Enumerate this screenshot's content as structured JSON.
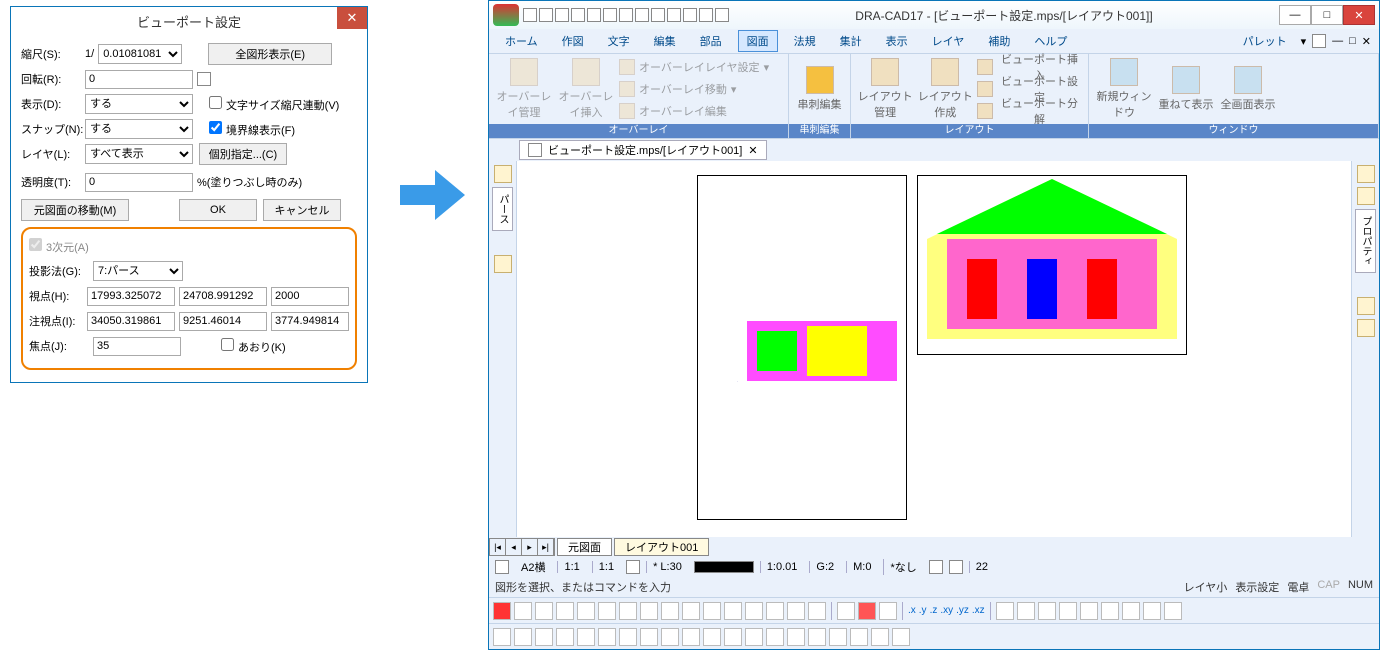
{
  "dialog": {
    "title": "ビューポート設定",
    "scale_label": "縮尺(S):",
    "scale_prefix": "1/",
    "scale_value": "0.01081081",
    "all_shapes_btn": "全図形表示(E)",
    "rotate_label": "回転(R):",
    "rotate_value": "0",
    "display_label": "表示(D):",
    "display_value": "する",
    "charsize_chk": "文字サイズ縮尺連動(V)",
    "snap_label": "スナップ(N):",
    "snap_value": "する",
    "boundary_chk": "境界線表示(F)",
    "layer_label": "レイヤ(L):",
    "layer_value": "すべて表示",
    "individual_btn": "個別指定...(C)",
    "opacity_label": "透明度(T):",
    "opacity_value": "0",
    "opacity_suffix": "%(塗りつぶし時のみ)",
    "move_orig_btn": "元図面の移動(M)",
    "ok_btn": "OK",
    "cancel_btn": "キャンセル",
    "threeD_chk": "3次元(A)",
    "proj_label": "投影法(G):",
    "proj_value": "7:パース",
    "viewpoint_label": "視点(H):",
    "viewpoint_x": "17993.325072",
    "viewpoint_y": "24708.991292",
    "viewpoint_z": "2000",
    "target_label": "注視点(I):",
    "target_x": "34050.319861",
    "target_y": "9251.46014",
    "target_z": "3774.949814",
    "focal_label": "焦点(J):",
    "focal_value": "35",
    "aori_chk": "あおり(K)"
  },
  "app": {
    "title": "DRA-CAD17 - [ビューポート設定.mps/[レイアウト001]]",
    "menu": {
      "home": "ホーム",
      "draw": "作図",
      "text": "文字",
      "edit": "編集",
      "parts": "部品",
      "zumen": "図面",
      "houki": "法規",
      "shukei": "集計",
      "hyouji": "表示",
      "layer": "レイヤ",
      "hojo": "補助",
      "help": "ヘルプ",
      "palette": "パレット"
    },
    "ribbon": {
      "overlay_manage": "オーバーレイ管理",
      "overlay_insert": "オーバーレイ挿入",
      "overlay_layer": "オーバーレイレイヤ設定",
      "overlay_move": "オーバーレイ移動",
      "overlay_edit": "オーバーレイ編集",
      "g_overlay": "オーバーレイ",
      "kushi": "串刺編集",
      "g_kushi": "串刺編集",
      "layout_manage": "レイアウト管理",
      "layout_create": "レイアウト作成",
      "vp_insert": "ビューポート挿入",
      "vp_set": "ビューポート設定",
      "vp_split": "ビューポート分解",
      "g_layout": "レイアウト",
      "new_window": "新規ウィンドウ",
      "tile": "重ねて表示",
      "full": "全画面表示",
      "g_window": "ウィンドウ"
    },
    "doctab": "ビューポート設定.mps/[レイアウト001]",
    "side_l_tab": "パース",
    "side_r_tab": "プロパティ",
    "layout_tabs": {
      "orig": "元図面",
      "l1": "レイアウト001"
    },
    "status": {
      "a2": "A2横",
      "r11a": "1:1",
      "r11b": "1:1",
      "l30": "* L:30",
      "scale2": "1:0.01",
      "g2": "G:2",
      "m0": "M:0",
      "nashi": "*なし",
      "n22": "22"
    },
    "cmd_prompt": "図形を選択、またはコマンドを入力",
    "cmd_right": {
      "layer_small": "レイヤ小",
      "disp_set": "表示設定",
      "calc": "電卓",
      "cap": "CAP",
      "num": "NUM"
    }
  }
}
